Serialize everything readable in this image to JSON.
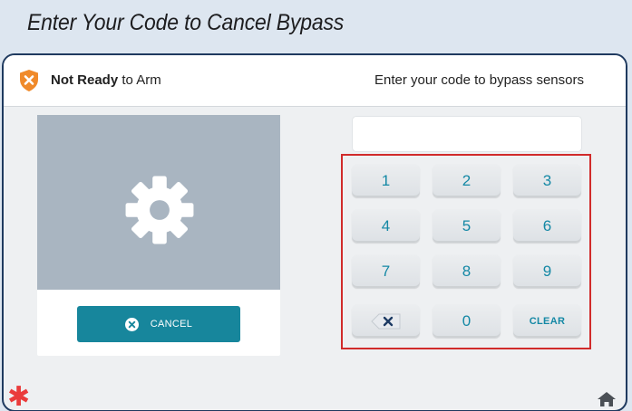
{
  "heading": "Enter Your Code to Cancel Bypass",
  "topbar": {
    "status_bold": "Not Ready",
    "status_rest": " to Arm",
    "status_icon": "shield-x-icon",
    "status_color": "#f08a2a",
    "instruction": "Enter your code to bypass sensors"
  },
  "left_panel": {
    "image_icon": "gear-icon",
    "cancel_label": "CANCEL",
    "cancel_icon": "close-circle-icon",
    "button_color": "#17869c"
  },
  "code_input": {
    "value": "",
    "placeholder": ""
  },
  "keypad": {
    "keys": [
      "1",
      "2",
      "3",
      "4",
      "5",
      "6",
      "7",
      "8",
      "9",
      "",
      "0",
      "CLEAR"
    ],
    "backspace_icon": "backspace-icon",
    "key_text_color": "#1488a5",
    "highlight_color": "#d12b2b"
  },
  "footer": {
    "left_icon": "asterisk-icon",
    "right_icon": "home-icon"
  }
}
